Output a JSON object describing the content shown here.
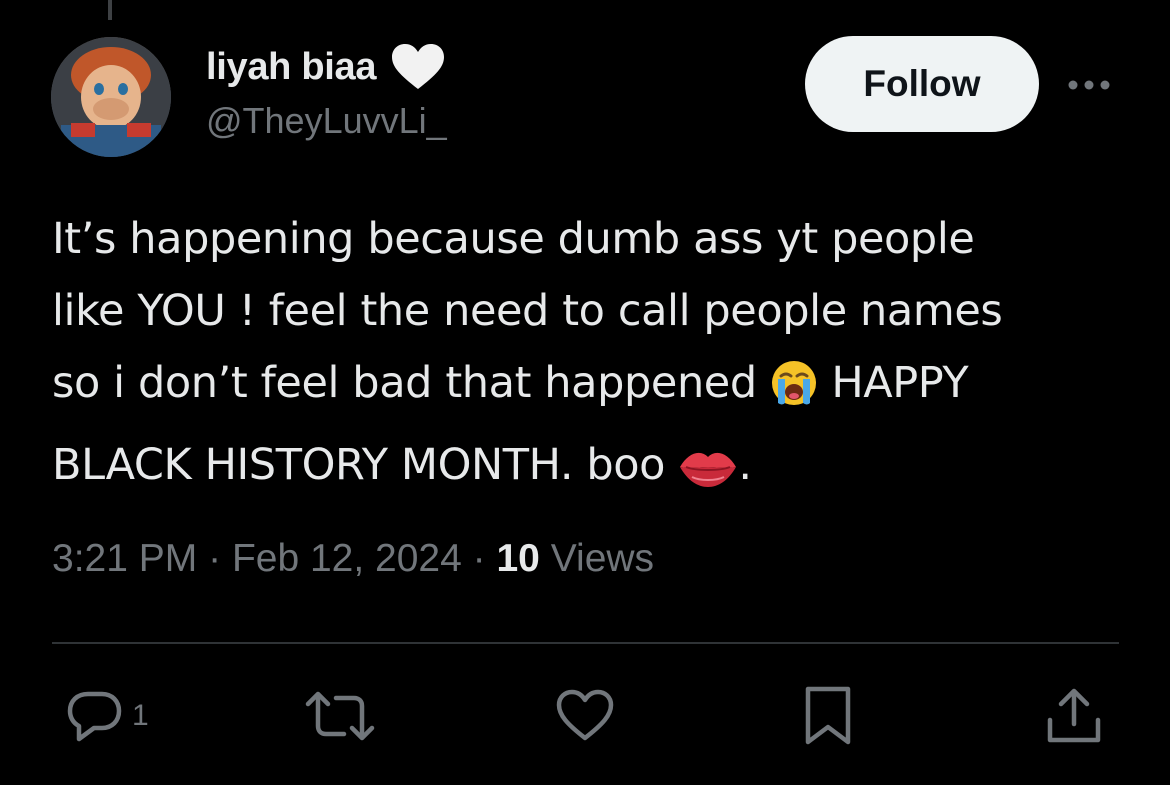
{
  "tweet": {
    "display_name": "liyah biaa",
    "handle": "@TheyLuvvLi_",
    "follow_label": "Follow",
    "text_lines": [
      "It’s happening because dumb ass yt people",
      "like YOU ! feel the need to call people names",
      "so i don’t feel bad that happened",
      "HAPPY",
      "BLACK HISTORY MONTH. boo",
      "."
    ],
    "time": "3:21 PM",
    "separator": "·",
    "date": "Feb 12, 2024",
    "views_count": "10",
    "views_label": "Views"
  },
  "actions": {
    "reply_count": "1"
  },
  "icons": {
    "name_badge": "white-heart-icon",
    "emoji_1": "loudly-crying-face-emoji",
    "emoji_2": "kiss-mark-emoji"
  },
  "colors": {
    "background": "#000000",
    "primary_text": "#e7e9ea",
    "secondary_text": "#71767b",
    "follow_button_bg": "#eff3f4",
    "divider": "#2f3336"
  }
}
